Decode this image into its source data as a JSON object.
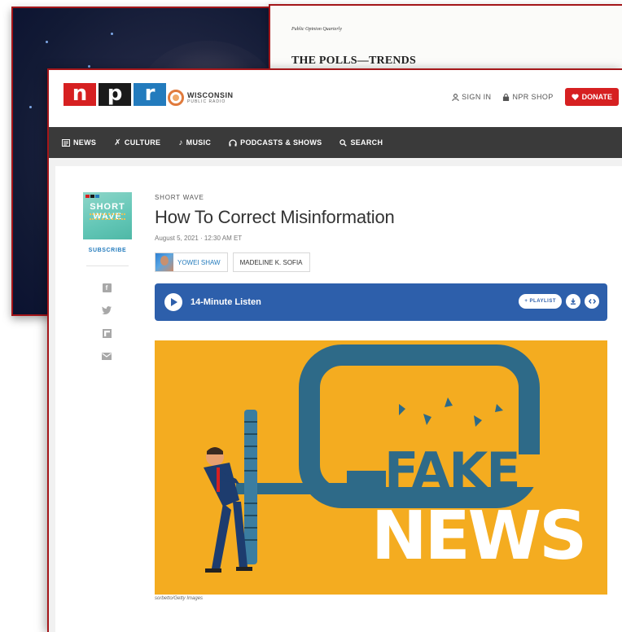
{
  "background_windows": {
    "journal": {
      "journal_name": "Public Opinion Quarterly",
      "heading": "THE POLLS—TRENDS"
    }
  },
  "header": {
    "logo_letters": [
      "n",
      "p",
      "r"
    ],
    "station_line1": "WISCONSIN",
    "station_line2": "PUBLIC RADIO",
    "sign_in": "SIGN IN",
    "npr_shop": "NPR SHOP",
    "donate": "DONATE"
  },
  "nav": {
    "items": [
      {
        "label": "NEWS",
        "icon": "newspaper-icon"
      },
      {
        "label": "CULTURE",
        "icon": "culture-icon"
      },
      {
        "label": "MUSIC",
        "icon": "music-note-icon"
      },
      {
        "label": "PODCASTS & SHOWS",
        "icon": "headphones-icon"
      },
      {
        "label": "SEARCH",
        "icon": "search-icon"
      }
    ]
  },
  "rail": {
    "podcast_title": "SHORT WAVE",
    "subscribe": "SUBSCRIBE",
    "share_icons": [
      "facebook-icon",
      "twitter-icon",
      "flipboard-icon",
      "email-icon"
    ]
  },
  "article": {
    "kicker": "SHORT WAVE",
    "headline": "How To Correct Misinformation",
    "dateline": "August 5, 2021 · 12:30 AM ET",
    "authors": [
      "YOWEI SHAW",
      "MADELINE K. SOFIA"
    ],
    "player_label": "14-Minute Listen",
    "playlist_label": "+ PLAYLIST",
    "image_text_top": "FAKE",
    "image_text_bottom": "NEWS",
    "image_caption": "sorbetto/Getty Images"
  },
  "colors": {
    "npr_red": "#d62021",
    "npr_black": "#1a1a1a",
    "npr_blue": "#237bbd",
    "player_blue": "#2d5fab",
    "hero_yellow": "#f4ac20",
    "window_border": "#a4161a"
  }
}
